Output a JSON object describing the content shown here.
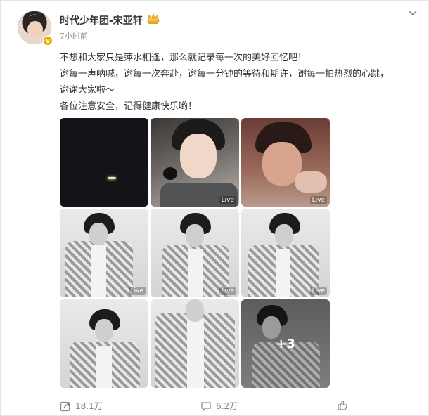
{
  "post": {
    "author": "时代少年团-宋亚轩",
    "time": "7小时前",
    "lines": [
      "不想和大家只是萍水相逢，那么就记录每一次的美好回忆吧！",
      "谢每一声呐喊，谢每一次奔赴，谢每一分钟的等待和期许，谢每一拍热烈的心跳，",
      "谢谢大家啦～",
      "各位注意安全，记得健康快乐哟！"
    ],
    "photos": [
      {
        "live": ""
      },
      {
        "live": "Live"
      },
      {
        "live": "Live"
      },
      {
        "live": "Live"
      },
      {
        "live": "Live"
      },
      {
        "live": "Live"
      },
      {
        "live": ""
      },
      {
        "live": ""
      },
      {
        "live": "",
        "more": "+3"
      }
    ]
  },
  "actions": {
    "share_count": "18.1万",
    "comment_count": "6.2万"
  },
  "colors": {
    "verified": "#f2a900",
    "text": "#333333",
    "muted": "#939393"
  },
  "icons": [
    "verified-badge-icon",
    "crown-icon",
    "chevron-down-icon",
    "share-icon",
    "comment-icon",
    "like-icon"
  ]
}
